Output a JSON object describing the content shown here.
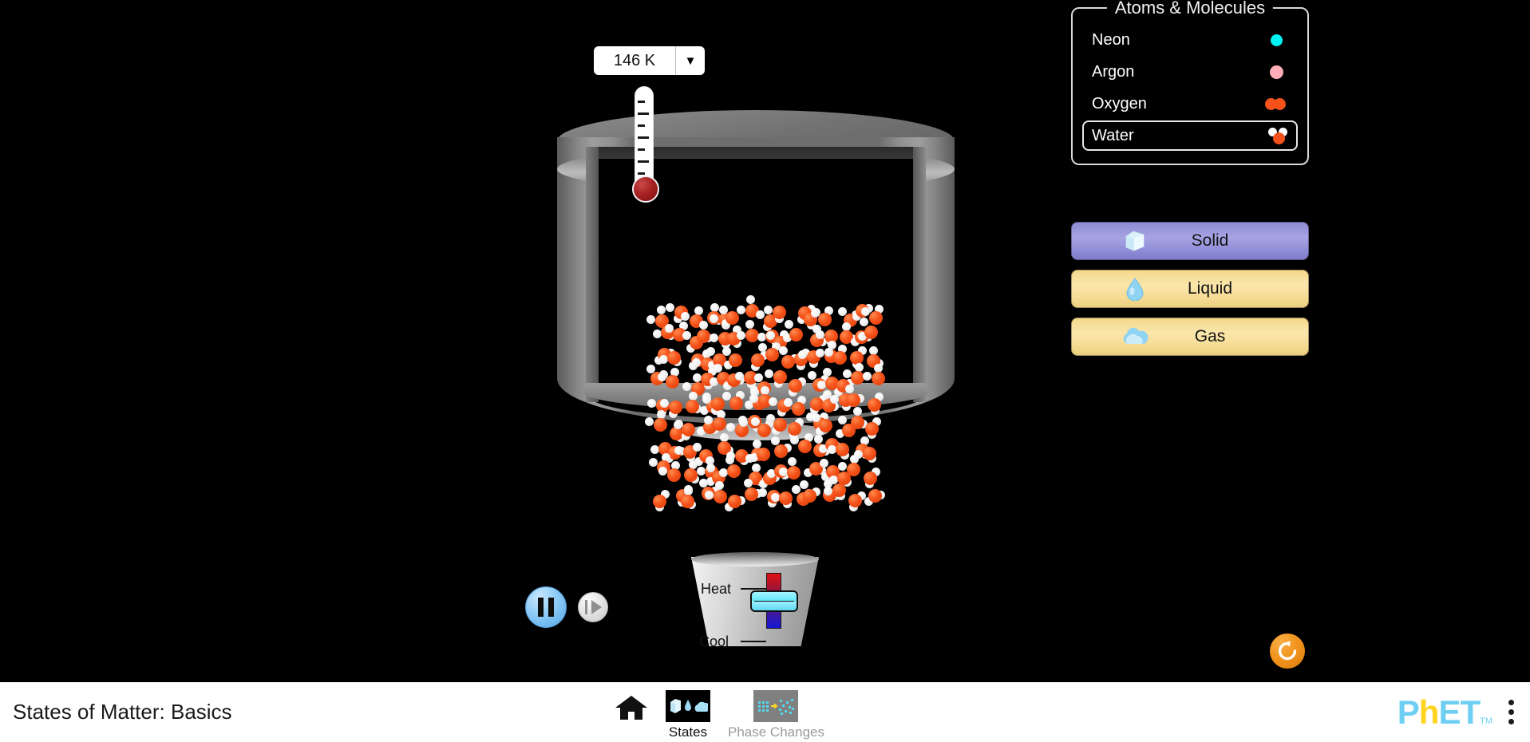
{
  "app": {
    "title": "States of Matter: Basics",
    "background_color": "#000000",
    "accent_color": "#f2941f"
  },
  "thermometer": {
    "temperature_value": "146 K",
    "units_toggle_icon": "chevron-down-icon",
    "fill_fraction": 0.12,
    "tick_count": 7
  },
  "container": {
    "name": "particle-container",
    "lid_state": "closed"
  },
  "particles": {
    "substance": "Water",
    "molecule_formula": "H2O",
    "oxygen_color": "#f4521a",
    "hydrogen_color": "#ffffff",
    "count": 135,
    "phase": "solid"
  },
  "heater_cooler": {
    "heat_label": "Heat",
    "cool_label": "Cool",
    "slider_position": 0,
    "hot_color": "#e01212",
    "cold_color": "#1616d6",
    "thumb_color": "#62e8fb"
  },
  "playback": {
    "pause_button_label": "Pause",
    "pause_icon": "pause-icon",
    "step_button_label": "Step Forward",
    "step_icon": "step-forward-icon",
    "is_playing": false
  },
  "reset": {
    "label": "Reset All",
    "icon": "reset-circular-arrow-icon"
  },
  "atoms_panel": {
    "title": "Atoms & Molecules",
    "selected": "Water",
    "items": [
      {
        "label": "Neon",
        "icon": "neon-atom-icon",
        "color": "#00f2f2",
        "type": "single",
        "selected": false
      },
      {
        "label": "Argon",
        "icon": "argon-atom-icon",
        "color": "#ffaeb9",
        "type": "single",
        "selected": false
      },
      {
        "label": "Oxygen",
        "icon": "oxygen-molecule-icon",
        "color": "#f4521a",
        "type": "diatomic",
        "selected": false
      },
      {
        "label": "Water",
        "icon": "water-molecule-icon",
        "color": "#f4521a",
        "type": "water",
        "selected": true
      }
    ]
  },
  "state_buttons": [
    {
      "label": "Solid",
      "icon": "ice-cube-icon",
      "color": "#a6a4e2",
      "selected": true
    },
    {
      "label": "Liquid",
      "icon": "water-drop-icon",
      "color": "#fae6ab",
      "selected": false
    },
    {
      "label": "Gas",
      "icon": "cloud-icon",
      "color": "#fae6ab",
      "selected": false
    }
  ],
  "navbar": {
    "title": "States of Matter: Basics",
    "home_icon": "home-icon",
    "tabs": [
      {
        "label": "States",
        "icon": "states-thumbnail-icon",
        "active": true
      },
      {
        "label": "Phase Changes",
        "icon": "phase-changes-thumbnail-icon",
        "active": false
      }
    ],
    "logo": {
      "p": "P",
      "h": "h",
      "e": "E",
      "t": "T",
      "tm": "TM"
    },
    "menu_icon": "kebab-menu-icon"
  }
}
